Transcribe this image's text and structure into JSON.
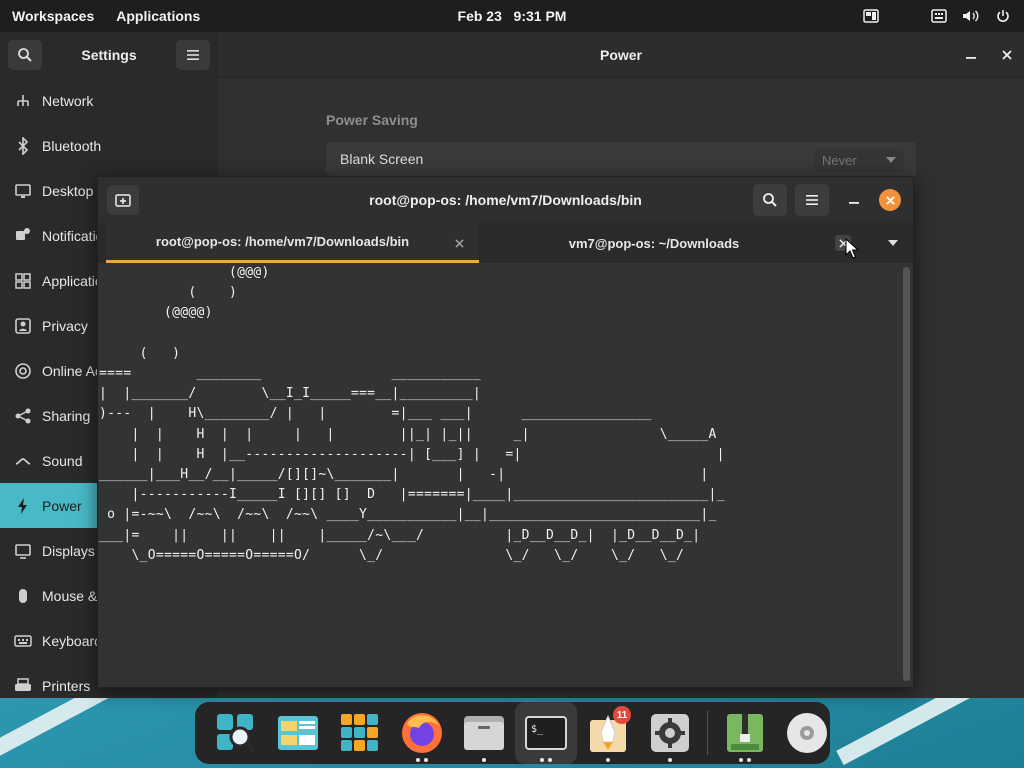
{
  "topbar": {
    "workspaces": "Workspaces",
    "applications": "Applications",
    "date": "Feb 23",
    "time": "9:31 PM"
  },
  "settings": {
    "title": "Settings",
    "page_title": "Power",
    "sidebar": [
      {
        "label": "Network",
        "icon": "network-icon"
      },
      {
        "label": "Bluetooth",
        "icon": "bluetooth-icon"
      },
      {
        "label": "Desktop",
        "icon": "desktop-icon"
      },
      {
        "label": "Notifications",
        "icon": "notifications-icon"
      },
      {
        "label": "Applications",
        "icon": "applications-icon"
      },
      {
        "label": "Privacy",
        "icon": "privacy-icon"
      },
      {
        "label": "Online Accounts",
        "icon": "online-accounts-icon"
      },
      {
        "label": "Sharing",
        "icon": "sharing-icon"
      },
      {
        "label": "Sound",
        "icon": "sound-icon"
      },
      {
        "label": "Power",
        "icon": "power-icon",
        "active": true
      },
      {
        "label": "Displays",
        "icon": "displays-icon"
      },
      {
        "label": "Mouse & Touchpad",
        "icon": "mouse-icon"
      },
      {
        "label": "Keyboard",
        "icon": "keyboard-icon"
      },
      {
        "label": "Printers",
        "icon": "printers-icon"
      }
    ],
    "power_saving": {
      "section_title": "Power Saving",
      "blank_screen_label": "Blank Screen",
      "blank_screen_value": "Never"
    }
  },
  "terminal": {
    "title": "root@pop-os: /home/vm7/Downloads/bin",
    "tabs": [
      {
        "label": "root@pop-os: /home/vm7/Downloads/bin",
        "active": true
      },
      {
        "label": "vm7@pop-os: ~/Downloads",
        "active": false
      }
    ],
    "ascii_art": "                (@@@)\n           (    )\n        (@@@@)\n\n     (   )\n====        ________                ___________\n|  |_______/        \\__I_I_____===__|_________|\n)---  |    H\\________/ |   |        =|___ ___|      ________________\n    |  |    H  |  |     |   |        ||_| |_||     _|                \\_____A\n    |  |    H  |__--------------------| [___] |   =|                        |\n______|___H__/__|_____/[][]~\\_______|       |   -|                        |\n    |-----------I_____I [][] []  D   |=======|____|________________________|_\n o |=-~~\\  /~~\\  /~~\\  /~~\\ ____Y___________|__|__________________________|_\n___|=    ||    ||    ||    |_____/~\\___/          |_D__D__D_|  |_D__D__D_|\n    \\_O=====O=====O=====O/      \\_/               \\_/   \\_/    \\_/   \\_/"
  },
  "dock": {
    "items": [
      {
        "name": "search-app",
        "dots": 0
      },
      {
        "name": "files-app",
        "dots": 0
      },
      {
        "name": "app-grid",
        "dots": 0
      },
      {
        "name": "firefox",
        "dots": 2
      },
      {
        "name": "file-manager",
        "dots": 1
      },
      {
        "name": "terminal",
        "dots": 2,
        "active": true
      },
      {
        "name": "app-center",
        "dots": 1,
        "badge": "11"
      },
      {
        "name": "settings-app",
        "dots": 1
      },
      {
        "name": "archive-manager",
        "dots": 2
      },
      {
        "name": "disks-app",
        "dots": 0
      }
    ]
  },
  "colors": {
    "accent": "#48b9c7",
    "close_orange": "#f0923d",
    "tab_underline": "#f0a741",
    "badge_red": "#e04a3c"
  }
}
